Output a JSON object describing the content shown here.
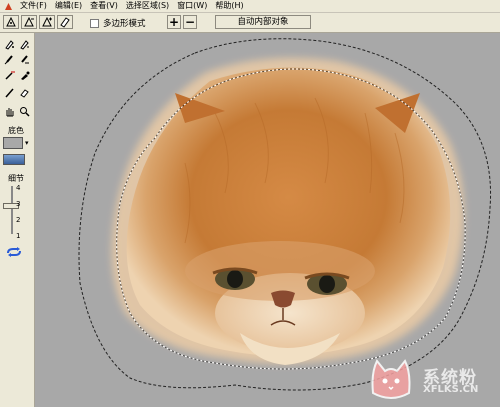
{
  "menubar": {
    "logo_icon": "app-logo-icon",
    "items": [
      "文件(F)",
      "编辑(E)",
      "查看(V)",
      "选择区域(S)",
      "窗口(W)",
      "帮助(H)"
    ]
  },
  "toolbar": {
    "lasso_polygon_icons": [
      "lasso-a-icon",
      "lasso-b-icon",
      "lasso-c-icon",
      "eraser-icon"
    ],
    "polygon_mode_label": "多边形模式",
    "polygon_mode_checked": false,
    "plus_label": "+",
    "minus_label": "−",
    "auto_button_label": "自动内部对象"
  },
  "left_panel": {
    "tools": [
      "pen-plus-icon",
      "pen-minus-icon",
      "brush-plus-icon",
      "brush-minus-icon",
      "magic-wand-icon",
      "dropper-icon",
      "pencil-icon",
      "eraser-small-icon",
      "hand-icon",
      "zoom-icon"
    ],
    "background_label": "底色",
    "detail_label": "细节",
    "ticks": [
      "4",
      "3",
      "2",
      "1"
    ],
    "refresh_icon": "refresh-icon",
    "colors": {
      "swatch": "#a8a8a8"
    }
  },
  "watermark": {
    "text": "系统粉",
    "url": "XFLKS.CN"
  },
  "colors": {
    "canvas_bg": "#a8a8a8",
    "fur": "#c57a35"
  }
}
